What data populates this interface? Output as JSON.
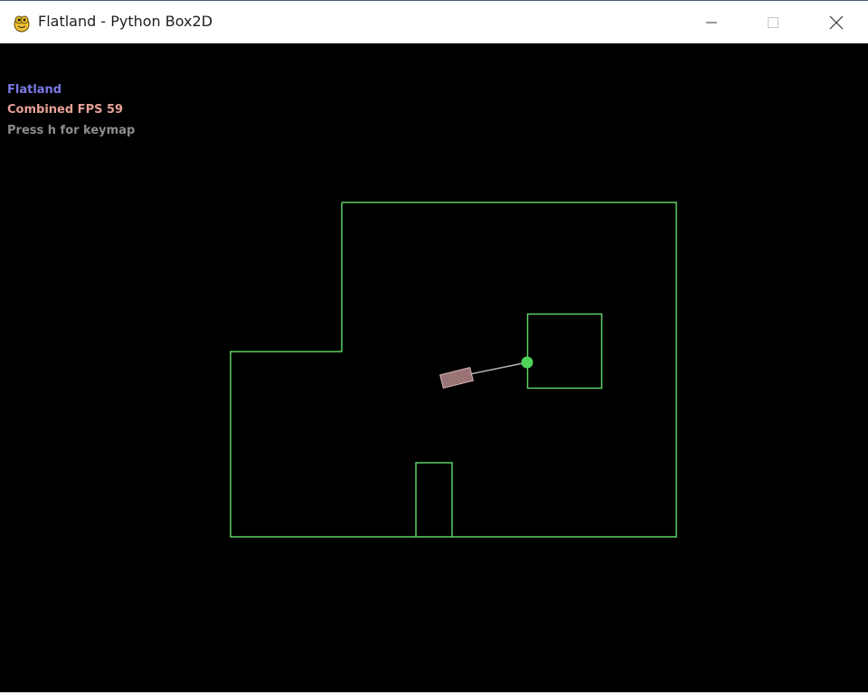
{
  "window": {
    "title": "Flatland - Python Box2D",
    "minimize_icon": "minimize-icon",
    "maximize_icon": "maximize-icon",
    "close_icon": "close-icon",
    "app_icon": "pygame-snake-icon"
  },
  "hud": {
    "title": "Flatland",
    "fps": "Combined FPS 59",
    "help": "Press h for keymap"
  },
  "colors": {
    "background": "#000000",
    "walls": "#5fd068",
    "agent_body": "#9a7474",
    "goal": "#4fd65a",
    "ray": "#b4b4b4"
  }
}
